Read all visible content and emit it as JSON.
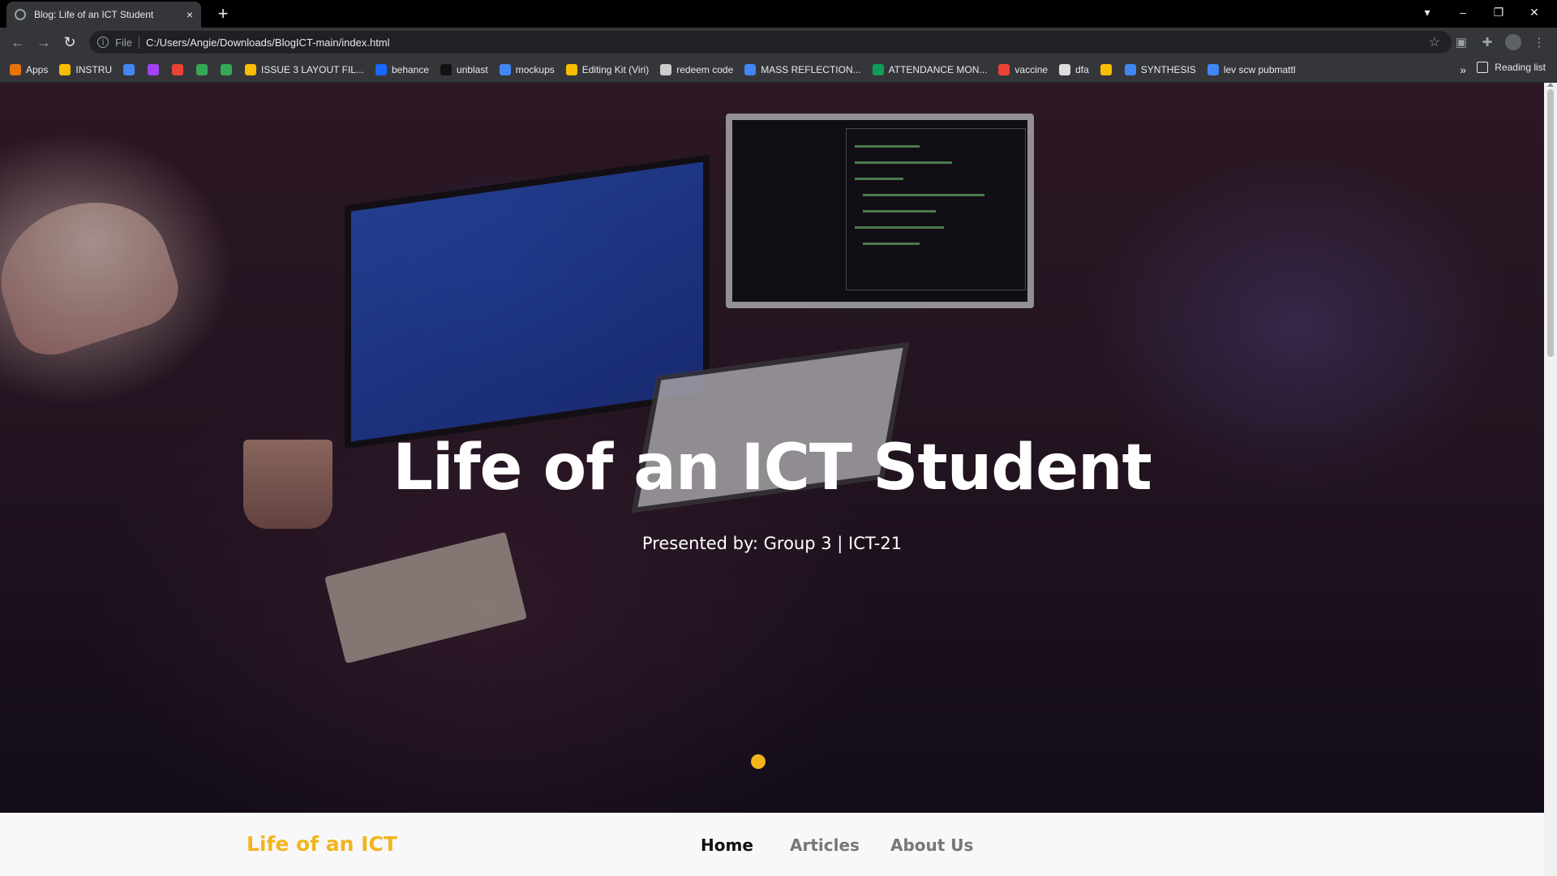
{
  "browser": {
    "tab_title": "Blog: Life of an ICT Student",
    "tab_close": "×",
    "new_tab": "+",
    "window": {
      "minimize": "–",
      "restore": "❐",
      "close": "✕"
    },
    "nav": {
      "back": "←",
      "forward": "→",
      "reload": "↻"
    },
    "address": {
      "scheme": "File",
      "url": "C:/Users/Angie/Downloads/BlogICT-main/index.html",
      "star": "☆"
    },
    "bookmarks": [
      {
        "label": "Apps",
        "color": "#e8710a"
      },
      {
        "label": "INSTRU",
        "color": "#fbbc04"
      },
      {
        "label": "",
        "color": "#4285f4"
      },
      {
        "label": "",
        "color": "#a142f4"
      },
      {
        "label": "",
        "color": "#ea4335"
      },
      {
        "label": "",
        "color": "#34a853"
      },
      {
        "label": "",
        "color": "#34a853"
      },
      {
        "label": "ISSUE 3 LAYOUT FIL...",
        "color": "#fbbc04"
      },
      {
        "label": "behance",
        "color": "#1769ff"
      },
      {
        "label": "unblast",
        "color": "#111111"
      },
      {
        "label": "mockups",
        "color": "#4285f4"
      },
      {
        "label": "Editing Kit (Viri)",
        "color": "#fbbc04"
      },
      {
        "label": "redeem code",
        "color": "#cccccc"
      },
      {
        "label": "MASS REFLECTION...",
        "color": "#4285f4"
      },
      {
        "label": "ATTENDANCE MON...",
        "color": "#0f9d58"
      },
      {
        "label": "vaccine",
        "color": "#ea4335"
      },
      {
        "label": "dfa",
        "color": "#dddddd"
      },
      {
        "label": "",
        "color": "#fbbc04"
      },
      {
        "label": "SYNTHESIS",
        "color": "#4285f4"
      },
      {
        "label": "lev scw pubmattl",
        "color": "#4285f4"
      }
    ],
    "bookmarks_more": "»",
    "reading_list": "Reading list"
  },
  "hero": {
    "title": "Life of an ICT Student",
    "subtitle": "Presented by: Group 3 | ICT-21"
  },
  "site_nav": {
    "brand": "Life of an ICT",
    "links": [
      "Home",
      "Articles",
      "About Us"
    ],
    "active": "Home",
    "accent": "#f2b51c"
  }
}
